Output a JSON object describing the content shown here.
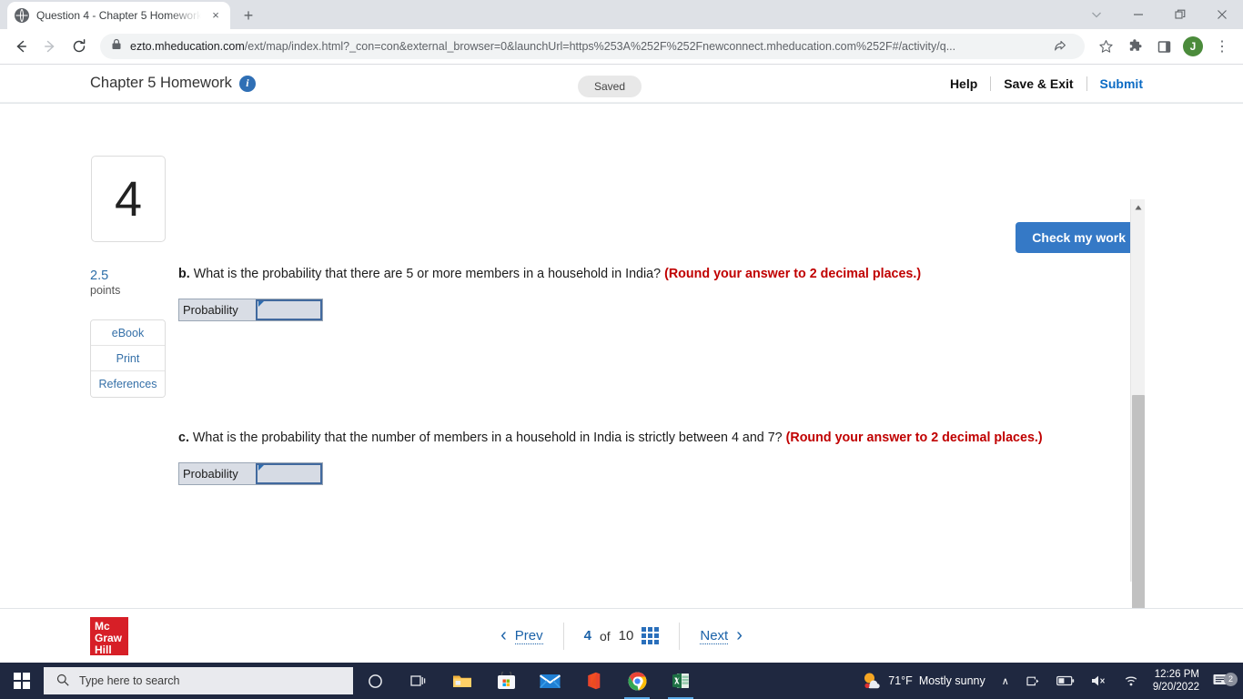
{
  "browser": {
    "tab": {
      "title": "Question 4 - Chapter 5 Homework",
      "favicon": "globe-icon",
      "close": "×"
    },
    "new_tab": "+",
    "window_controls": {
      "tab_search": "∨",
      "minimize": "—",
      "maximize": "❐",
      "close": "✕"
    },
    "nav": {
      "back": "←",
      "forward": "→",
      "reload": "↻"
    },
    "url_host": "ezto.mheducation.com",
    "url_path": "/ext/map/index.html?_con=con&external_browser=0&launchUrl=https%253A%252F%252Fnewconnect.mheducation.com%252F#/activity/q...",
    "lock_icon": "padlock-icon",
    "toolbar_icons": [
      "share-icon",
      "bookmark-star-icon",
      "extensions-puzzle-icon",
      "side-panel-icon"
    ],
    "profile_initial": "J",
    "menu": "⋮"
  },
  "header": {
    "title": "Chapter 5 Homework",
    "info_icon": "i",
    "status": "Saved",
    "actions": [
      {
        "label": "Help"
      },
      {
        "label": "Save & Exit"
      },
      {
        "label": "Submit"
      }
    ]
  },
  "question": {
    "number": "4",
    "points_value": "2.5",
    "points_label": "points",
    "side_buttons": [
      {
        "label": "eBook"
      },
      {
        "label": "Print"
      },
      {
        "label": "References"
      }
    ],
    "check_button": "Check my work",
    "parts": [
      {
        "letter": "b.",
        "text": "What is the probability that there are 5 or more members in a household in India?",
        "note": "(Round your answer to 2 decimal places.)",
        "field_label": "Probability",
        "field_value": ""
      },
      {
        "letter": "c.",
        "text": "What is the probability that the number of members in a household in India is strictly between 4 and 7?",
        "note": "(Round your answer to 2 decimal places.)",
        "field_label": "Probability",
        "field_value": ""
      }
    ]
  },
  "footer": {
    "logo_lines": [
      "Mc",
      "Graw",
      "Hill"
    ],
    "prev": "Prev",
    "next": "Next",
    "current_page": "4",
    "of": "of",
    "total_pages": "10",
    "prev_chevron": "‹",
    "next_chevron": "›",
    "grid_icon": "question-grid-icon"
  },
  "taskbar": {
    "start": "windows-start-icon",
    "search_placeholder": "Type here to search",
    "search_icon": "search-icon",
    "cortana_icon": "cortana-circle-icon",
    "taskview_icon": "task-view-icon",
    "apps": [
      {
        "name": "file-explorer",
        "active": false
      },
      {
        "name": "microsoft-store",
        "active": false
      },
      {
        "name": "mail",
        "active": false
      },
      {
        "name": "office",
        "active": false
      },
      {
        "name": "google-chrome",
        "active": true
      },
      {
        "name": "excel",
        "active": true
      }
    ],
    "weather_temp": "71°F",
    "weather_desc": "Mostly sunny",
    "tray_expand": "∧",
    "tray_icons": [
      "onedrive-icon",
      "battery-icon",
      "volume-muted-icon",
      "wifi-icon"
    ],
    "time": "12:26 PM",
    "date": "9/20/2022",
    "notifications_count": "2"
  },
  "colors": {
    "accent_blue": "#3579c6",
    "link_blue": "#1b62a8",
    "note_red": "#c00000",
    "mcgraw_red": "#d71f27",
    "taskbar": "#1f2840"
  }
}
